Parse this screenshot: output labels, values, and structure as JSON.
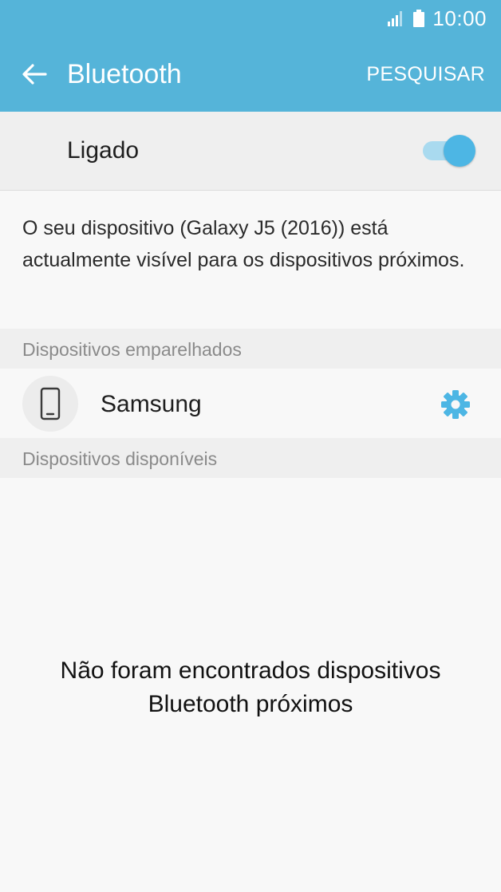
{
  "status_bar": {
    "time": "10:00",
    "signal_icon": "signal-icon",
    "battery_icon": "battery-icon"
  },
  "app_bar": {
    "back_icon": "arrow-left-icon",
    "title": "Bluetooth",
    "action_label": "PESQUISAR",
    "color": "#55b4d9"
  },
  "toggle": {
    "label": "Ligado",
    "state": "on",
    "accent_color": "#4db6e4"
  },
  "description": "O seu dispositivo (Galaxy J5 (2016)) está actualmente visível para os dispositivos próximos.",
  "paired_section": {
    "title": "Dispositivos emparelhados",
    "devices": [
      {
        "name": "Samsung",
        "icon": "smartphone-icon",
        "settings_icon": "gear-icon"
      }
    ]
  },
  "available_section": {
    "title": "Dispositivos disponíveis",
    "empty_message_line1": "Não foram encontrados dispositivos",
    "empty_message_line2": "Bluetooth próximos"
  }
}
